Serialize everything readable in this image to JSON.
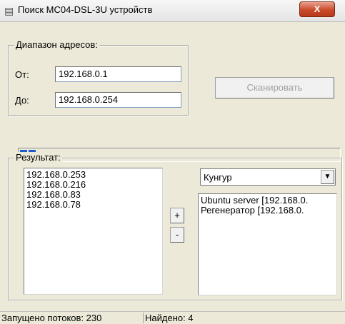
{
  "window": {
    "title": "Поиск МС04-DSL-3U устройств",
    "close_label": "X"
  },
  "address_range": {
    "group_label": "Диапазон адресов:",
    "from_label": "От:",
    "from_value": "192.168.0.1",
    "to_label": "До:",
    "to_value": "192.168.0.254",
    "scan_button": "Сканировать",
    "scan_button_enabled": false
  },
  "progress": {
    "fraction": 0.07
  },
  "results": {
    "group_label": "Результат:",
    "found_ips": [
      "192.168.0.253",
      "192.168.0.216",
      "192.168.0.83",
      "192.168.0.78"
    ],
    "add_button": "+",
    "remove_button": "-",
    "location_select": "Кунгур",
    "assigned_devices": [
      "Ubuntu server [192.168.0.",
      "Регенератор [192.168.0."
    ]
  },
  "status": {
    "threads": "Запущено потоков: 230",
    "found": "Найдено: 4"
  },
  "colors": {
    "progress_fill": "#1c5bd1",
    "close_button": "#c84a2b"
  }
}
